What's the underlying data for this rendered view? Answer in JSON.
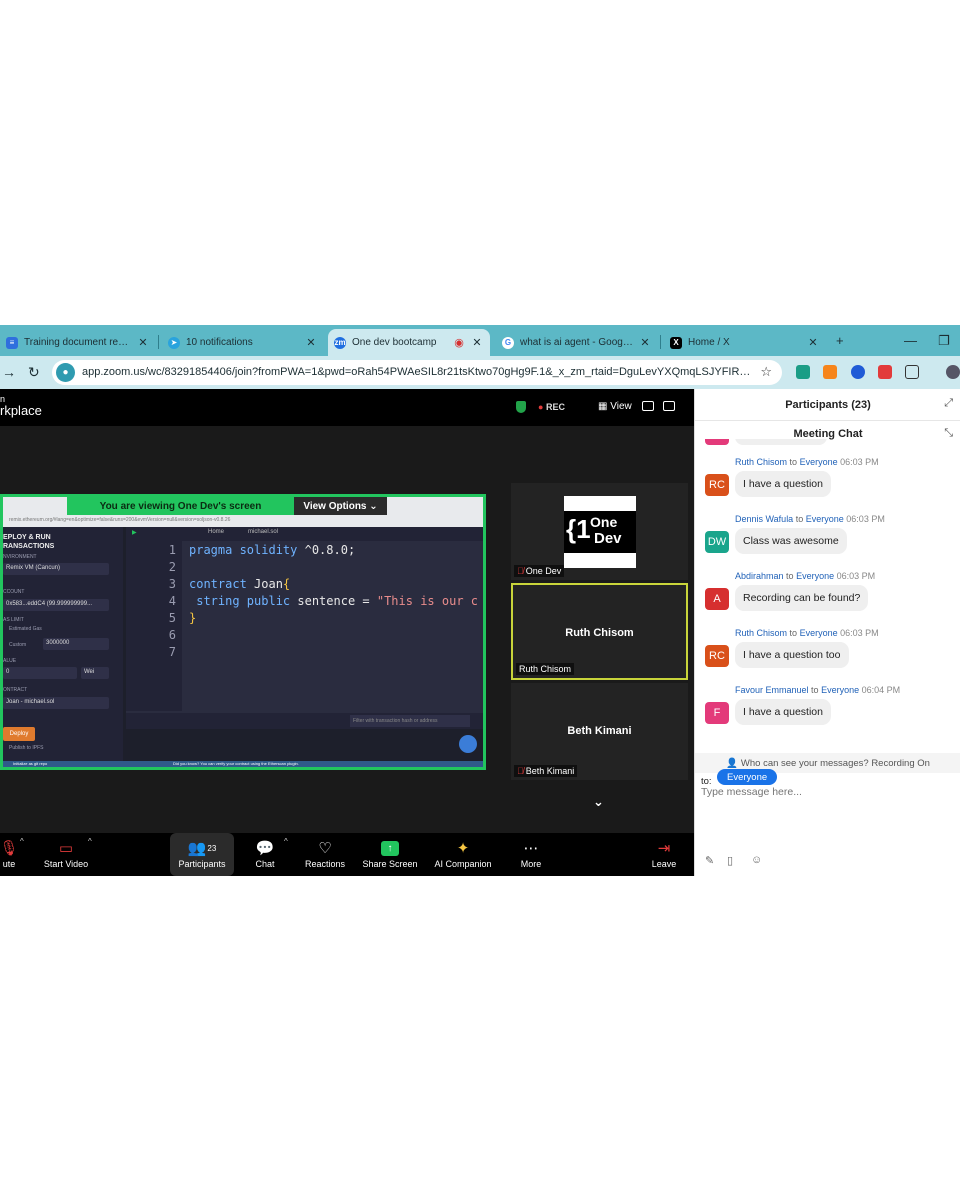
{
  "browser": {
    "tabs": [
      {
        "title": "Training document report (.)",
        "favicon_color": "#2f6fde"
      },
      {
        "title": "10 notifications",
        "favicon_color": "#2aa3dd"
      },
      {
        "title": "One dev bootcamp",
        "favicon_color": "#1f6fe0",
        "favicon_text": "zm"
      },
      {
        "title": "what is ai agent - Google Se",
        "favicon_color": "#4285f4"
      },
      {
        "title": "Home / X",
        "favicon_color": "#000000"
      }
    ],
    "url": "app.zoom.us/wc/83291854406/join?fromPWA=1&pwd=oRah54PWAeSIL8r21tsKtwo70gHg9F.1&_x_zm_rtaid=DguLevYXQmqLSJYFIRIBdA.173..."
  },
  "zoom": {
    "logo_line1": "n",
    "logo_line2": "rkplace",
    "rec_label": "REC",
    "view_label": "View",
    "viewing_banner": "You are viewing  One Dev's screen",
    "view_options": "View Options",
    "shared_screen": {
      "url": "remix.ethereum.org/#lang=en&optimize=false&runs=200&evmVersion=null&version=soljson-v0.8.26",
      "panel_title_1": "EPLOY & RUN",
      "panel_title_2": "RANSACTIONS",
      "env_label": "NVIRONMENT",
      "env_value": "Remix VM (Cancun)",
      "account_label": "CCOUNT",
      "account_value": "0x583...eddC4 (99.999999999...",
      "gas_label": "AS LIMIT",
      "gas_estimated": "Estimated Gas",
      "gas_custom": "Custom",
      "gas_value": "3000000",
      "value_label": "ALUE",
      "value_amount": "0",
      "value_unit": "Wei",
      "contract_label": "ONTRACT",
      "contract_value": "Joan - michael.sol",
      "deploy": "Deploy",
      "publish": "Publish to IPFS",
      "tab_home": "Home",
      "tab_file": "michael.sol",
      "line_numbers": [
        "1",
        "2",
        "3",
        "4",
        "5",
        "6",
        "7"
      ],
      "filter_placeholder": "Filter with transaction hash or address",
      "status_left": "Initialize as git repo",
      "status_mid": "Did you know?  You can verify your contract using the Etherscan plugin."
    },
    "tiles": [
      {
        "name": "One Dev",
        "logo_one": "One",
        "logo_dev": "Dev"
      },
      {
        "name": "Ruth Chisom",
        "center": "Ruth Chisom"
      },
      {
        "name": "Beth Kimani",
        "center": "Beth Kimani"
      }
    ],
    "toolbar": {
      "mute": "ute",
      "start_video": "Start Video",
      "participants": "Participants",
      "participants_count": "23",
      "chat": "Chat",
      "reactions": "Reactions",
      "share_screen": "Share Screen",
      "ai_companion": "AI Companion",
      "more": "More",
      "leave": "Leave"
    }
  },
  "side": {
    "participants_title": "Participants (23)",
    "chat_title": "Meeting Chat",
    "messages": [
      {
        "sender": "Ruth Chisom",
        "to": "to",
        "recipient": "Everyone",
        "time": "06:03 PM",
        "initials": "RC",
        "color": "#d9501a",
        "text": "I have a question"
      },
      {
        "sender": "Dennis Wafula",
        "to": "to",
        "recipient": "Everyone",
        "time": "06:03 PM",
        "initials": "DW",
        "color": "#1aa58c",
        "text": "Class was awesome"
      },
      {
        "sender": "Abdirahman",
        "to": "to",
        "recipient": "Everyone",
        "time": "06:03 PM",
        "initials": "A",
        "color": "#d62f2f",
        "text": "Recording can be found?"
      },
      {
        "sender": "Ruth Chisom",
        "to": "to",
        "recipient": "Everyone",
        "time": "06:03 PM",
        "initials": "RC",
        "color": "#d9501a",
        "text": "I have a question too"
      },
      {
        "sender": "Favour Emmanuel",
        "to": "to",
        "recipient": "Everyone",
        "time": "06:04 PM",
        "initials": "F",
        "color": "#e33a7a",
        "text": "I have a question"
      }
    ],
    "notice": "Who can see your messages? Recording On",
    "to_label": "to:",
    "recipient": "Everyone",
    "input_placeholder": "Type message here..."
  }
}
